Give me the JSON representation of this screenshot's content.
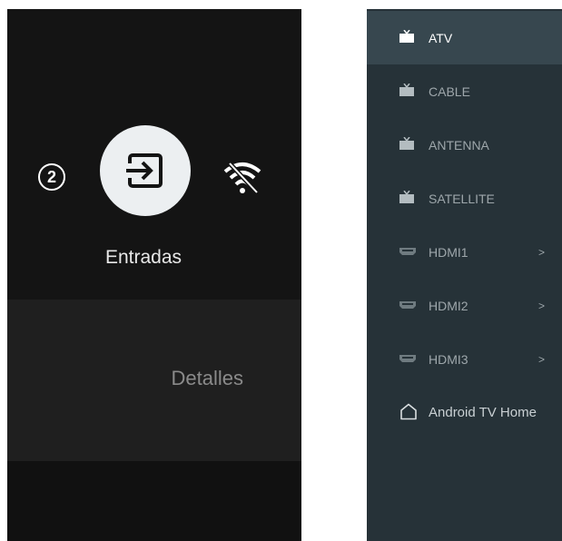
{
  "left_panel": {
    "badge_count": "2",
    "input_icon": "input-icon",
    "title": "Entradas",
    "wifi_icon": "wifi-off-icon",
    "details_label": "Detalles"
  },
  "sources": [
    {
      "label": "ATV",
      "icon": "tv-icon",
      "active": true
    },
    {
      "label": "CABLE",
      "icon": "tv-icon"
    },
    {
      "label": "ANTENNA",
      "icon": "tv-icon"
    },
    {
      "label": "SATELLITE",
      "icon": "tv-icon"
    },
    {
      "label": "HDMI1",
      "icon": "hdmi-icon",
      "chevron": ">"
    },
    {
      "label": "HDMI2",
      "icon": "hdmi-icon",
      "chevron": ">"
    },
    {
      "label": "HDMI3",
      "icon": "hdmi-icon",
      "chevron": ">"
    },
    {
      "label": "Android TV Home",
      "icon": "home-icon"
    }
  ]
}
